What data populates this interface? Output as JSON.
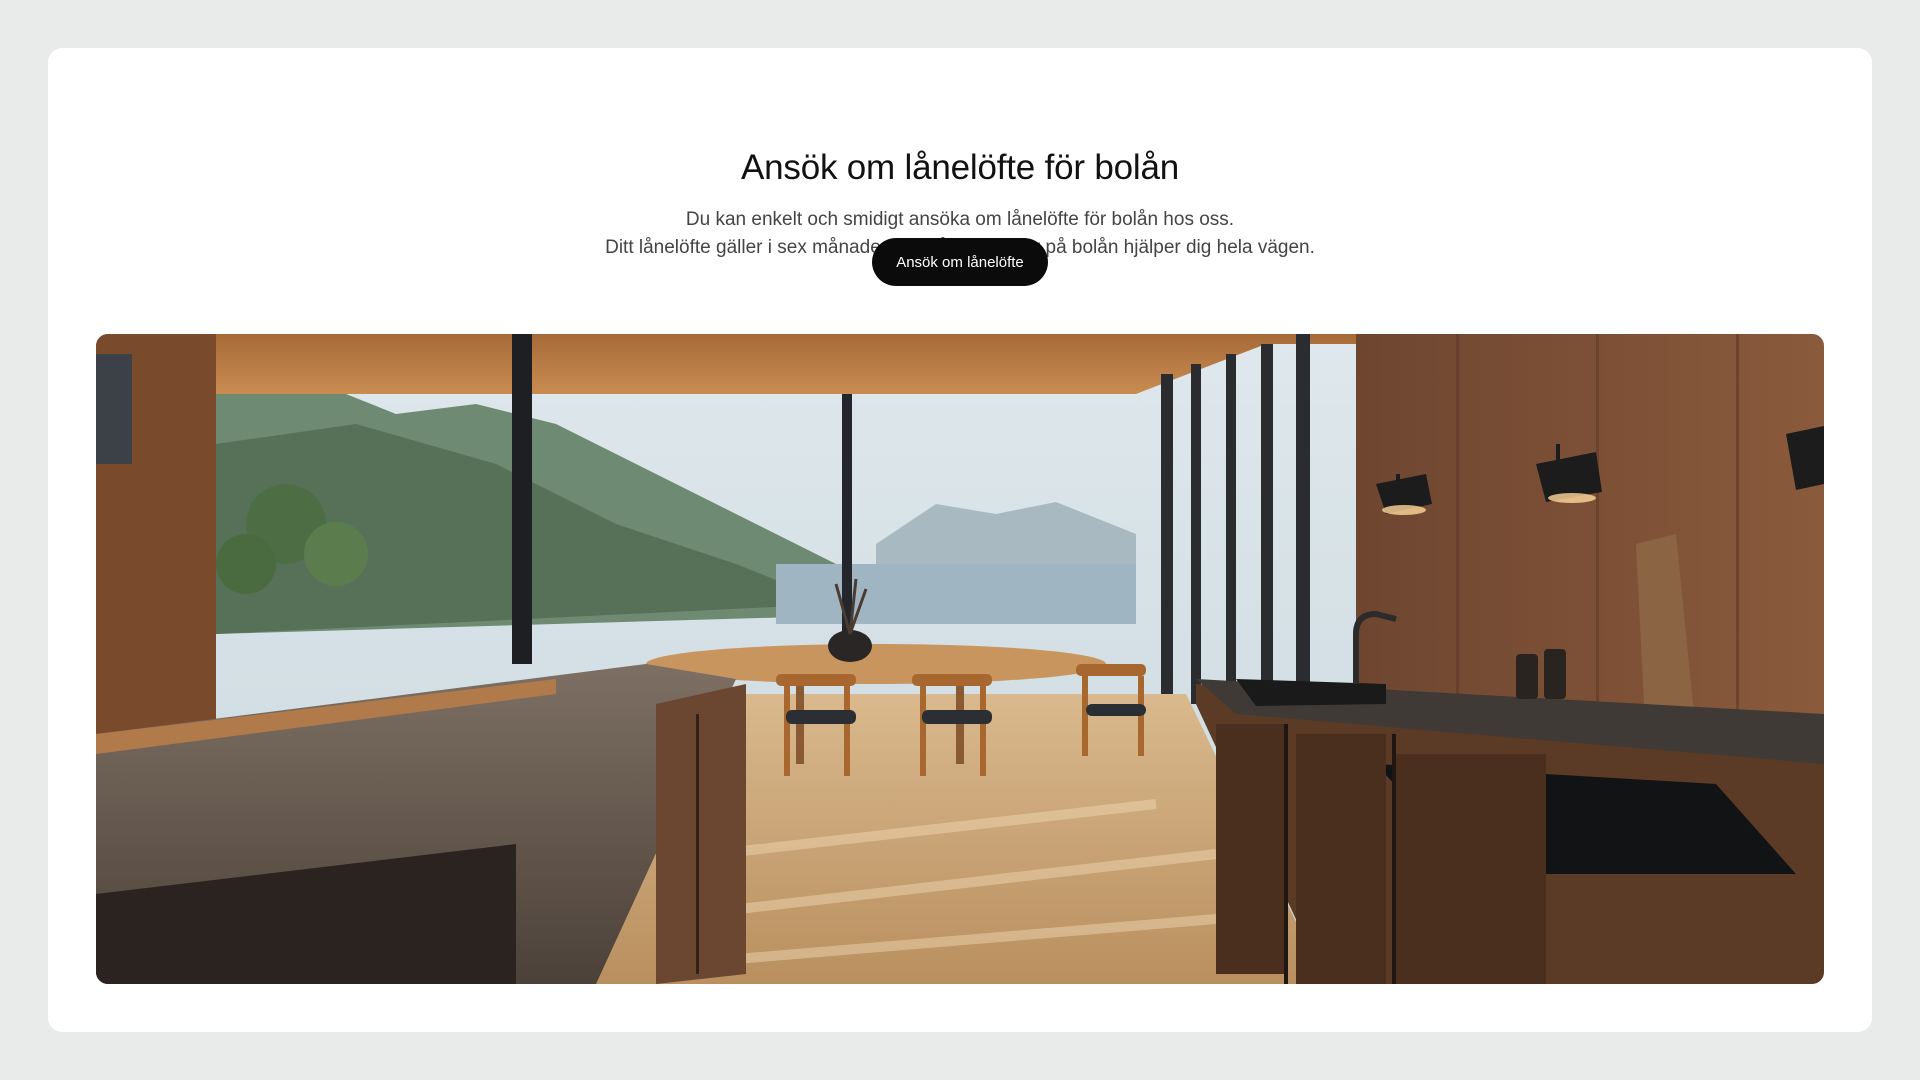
{
  "hero": {
    "title": "Ansök om lånelöfte för bolån",
    "description_line1": "Du kan enkelt och smidigt ansöka om lånelöfte för bolån hos oss.",
    "description_line2": "Ditt lånelöfte gäller i sex månader och våra experter på bolån hjälper dig hela vägen.",
    "cta_label": "Ansök om lånelöfte"
  },
  "colors": {
    "page_background": "#e9ebea",
    "card_background": "#ffffff",
    "button_background": "#0b0b0b",
    "button_text": "#ffffff"
  }
}
